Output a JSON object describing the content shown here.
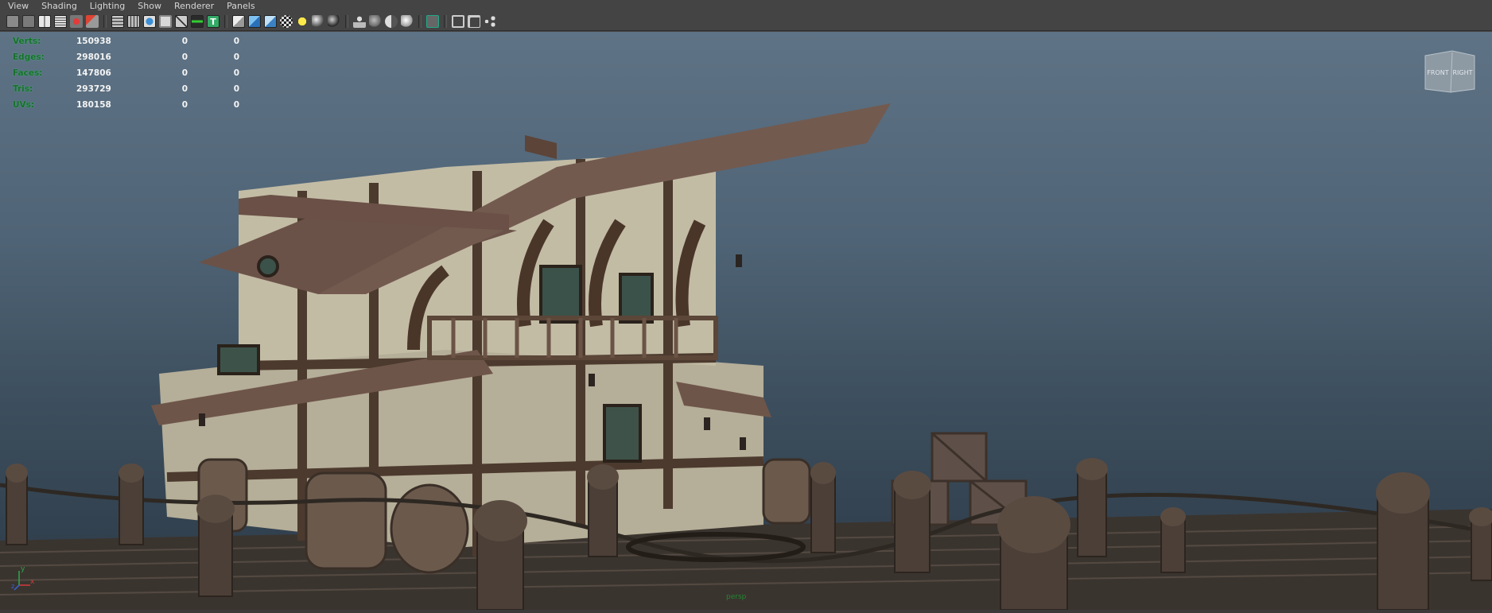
{
  "menu": {
    "items": [
      "View",
      "Shading",
      "Lighting",
      "Show",
      "Renderer",
      "Panels"
    ]
  },
  "toolbar": {
    "icons": [
      "camera-select-icon",
      "camera-attributes-icon",
      "bookmarks-icon",
      "image-plane-icon",
      "two-d-pan-zoom-icon",
      "grease-pencil-icon",
      "grid-icon",
      "film-gate-icon",
      "resolution-gate-icon",
      "gate-mask-icon",
      "field-chart-icon",
      "safe-title-icon",
      "wireframe-icon",
      "smooth-shade-icon",
      "default-material-icon",
      "textured-icon",
      "use-all-lights-icon",
      "shadows-icon",
      "screen-space-ambient-occlusion-icon",
      "xray-icon",
      "xray-joints-icon",
      "xray-components-icon",
      "backface-culling-icon",
      "isolate-select-icon",
      "toggle-viewport-icon",
      "two-sided-lighting-icon",
      "share-icon"
    ]
  },
  "hud": {
    "rows": [
      {
        "label": "Verts:",
        "v1": "150938",
        "v2": "0",
        "v3": "0"
      },
      {
        "label": "Edges:",
        "v1": "298016",
        "v2": "0",
        "v3": "0"
      },
      {
        "label": "Faces:",
        "v1": "147806",
        "v2": "0",
        "v3": "0"
      },
      {
        "label": "Tris:",
        "v1": "293729",
        "v2": "0",
        "v3": "0"
      },
      {
        "label": "UVs:",
        "v1": "180158",
        "v2": "0",
        "v3": "0"
      }
    ]
  },
  "viewcube": {
    "front": "FRONT",
    "right": "RIGHT"
  },
  "axis": {
    "y": "y",
    "x": "x",
    "z": "z"
  },
  "camera": {
    "name": "persp"
  }
}
